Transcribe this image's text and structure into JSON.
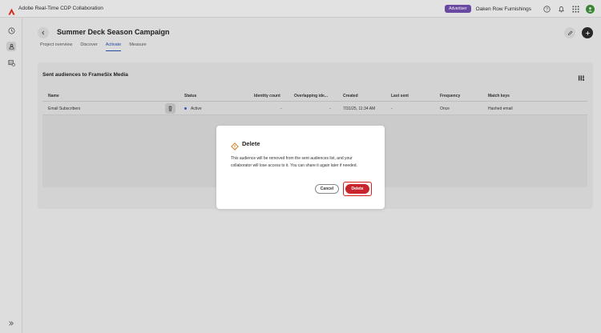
{
  "app": {
    "title": "Adobe Real-Time CDP Collaboration",
    "badge": "Advertiser",
    "org_name": "Oaken Row Furnishings",
    "icons": [
      "help-icon",
      "bell-icon",
      "apps-grid-icon",
      "avatar"
    ]
  },
  "rail": {
    "items": [
      "clock-icon",
      "audiences-icon",
      "data-sources-icon"
    ],
    "expand_icon": "chevron-double-right-icon"
  },
  "header": {
    "title": "Summer Deck Season Campaign",
    "tabs": [
      {
        "label": "Project overview"
      },
      {
        "label": "Discover"
      },
      {
        "label": "Activate"
      },
      {
        "label": "Measure"
      }
    ],
    "active_tab": "Activate"
  },
  "card": {
    "title": "Sent audiences to FrameSix Media",
    "columns": [
      "Name",
      "Status",
      "Identity count",
      "Overlapping ide...",
      "Created",
      "Last sent",
      "Frequency",
      "Match keys"
    ],
    "rows": [
      {
        "name": "Email Subscribers",
        "status": "Active",
        "identity_count": "-",
        "overlapping": "-",
        "created": "7/31/25, 11:34 AM",
        "last_sent": "-",
        "frequency": "Once",
        "match_keys": "Hashed email"
      }
    ]
  },
  "dialog": {
    "title": "Delete",
    "body": "This audience will be removed from the sent audiences list, and your collaborator will lose access to it. You can share it again later if needed.",
    "cancel_label": "Cancel",
    "delete_label": "Delete"
  },
  "colors": {
    "accent": "#2a4ea8",
    "badge": "#6e4ba8",
    "danger": "#c9252c",
    "status_active": "#3b5cc4"
  }
}
